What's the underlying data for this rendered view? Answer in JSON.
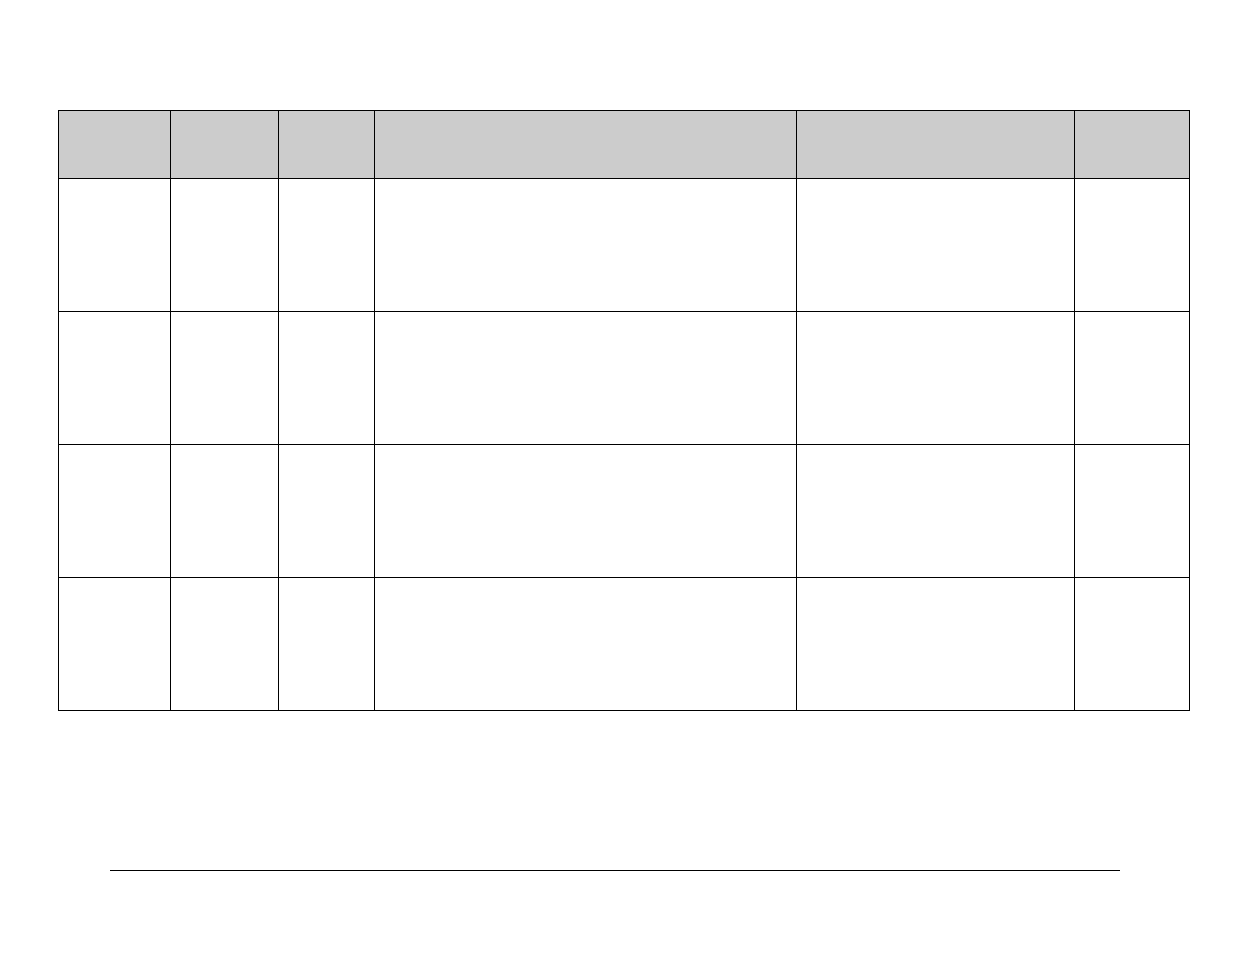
{
  "table": {
    "headers": [
      "",
      "",
      "",
      "",
      "",
      ""
    ],
    "rows": [
      [
        "",
        "",
        "",
        "",
        "",
        ""
      ],
      [
        "",
        "",
        "",
        "",
        "",
        ""
      ],
      [
        "",
        "",
        "",
        "",
        "",
        ""
      ],
      [
        "",
        "",
        "",
        "",
        "",
        ""
      ]
    ]
  }
}
